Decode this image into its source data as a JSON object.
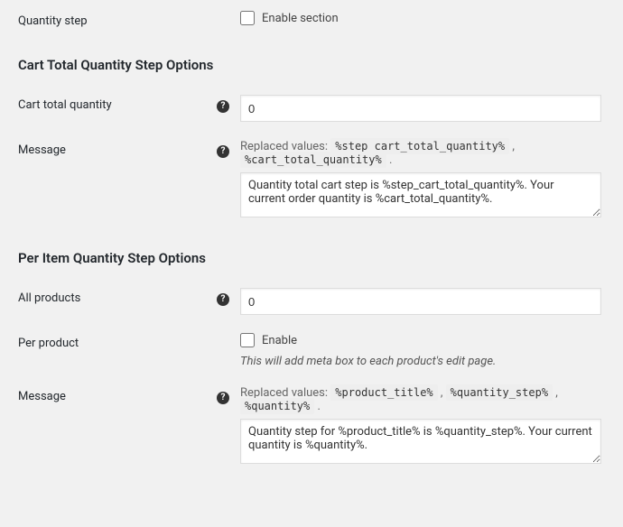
{
  "row1": {
    "label": "Quantity step",
    "checkbox_label": "Enable section"
  },
  "section1": {
    "heading": "Cart Total Quantity Step Options",
    "cart_total": {
      "label": "Cart total quantity",
      "value": "0"
    },
    "message": {
      "label": "Message",
      "hint_prefix": "Replaced values: ",
      "token1": "%step_cart_total_quantity%",
      "token2": "%cart_total_quantity%",
      "value": "Quantity total cart step is %step_cart_total_quantity%. Your current order quantity is %cart_total_quantity%."
    }
  },
  "section2": {
    "heading": "Per Item Quantity Step Options",
    "all_products": {
      "label": "All products",
      "value": "0"
    },
    "per_product": {
      "label": "Per product",
      "checkbox_label": "Enable",
      "desc": "This will add meta box to each product's edit page."
    },
    "message": {
      "label": "Message",
      "hint_prefix": "Replaced values: ",
      "token1": "%product_title%",
      "token2": "%quantity_step%",
      "token3": "%quantity%",
      "value": "Quantity step for %product_title% is %quantity_step%. Your current quantity is %quantity%."
    }
  },
  "punct": {
    "comma": " , ",
    "period": " ."
  }
}
